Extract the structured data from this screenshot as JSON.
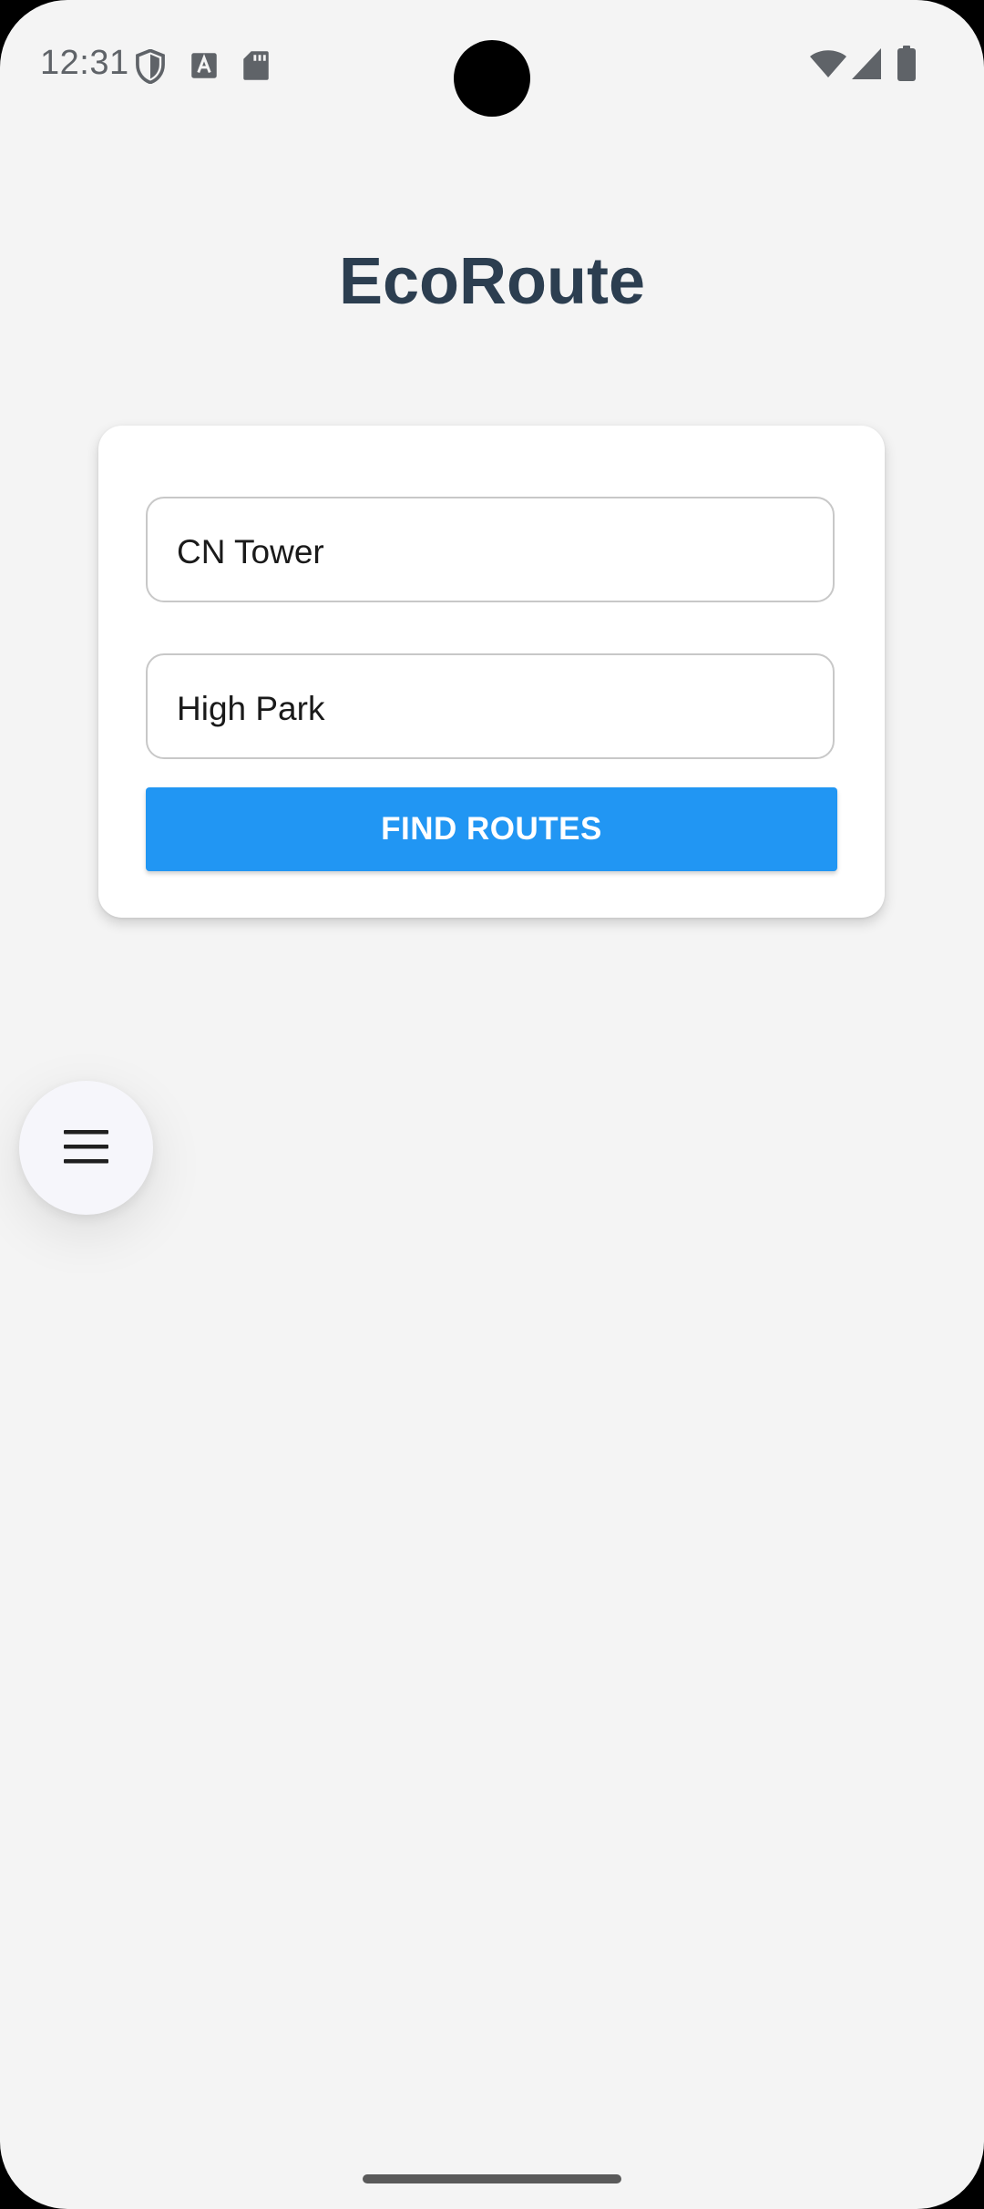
{
  "status_bar": {
    "time": "12:31",
    "left_icons": [
      "shield-icon",
      "text-a-icon",
      "sd-card-icon"
    ],
    "right_icons": [
      "wifi-icon",
      "cellular-signal-icon",
      "battery-icon"
    ]
  },
  "app": {
    "title": "EcoRoute"
  },
  "route_form": {
    "origin_value": "CN Tower",
    "destination_value": "High Park",
    "find_button_label": "FIND ROUTES"
  },
  "menu_fab": {
    "icon": "hamburger-menu-icon"
  },
  "colors": {
    "background": "#f4f4f4",
    "title": "#2c3e50",
    "primary_button": "#2196f3",
    "card": "#ffffff"
  }
}
